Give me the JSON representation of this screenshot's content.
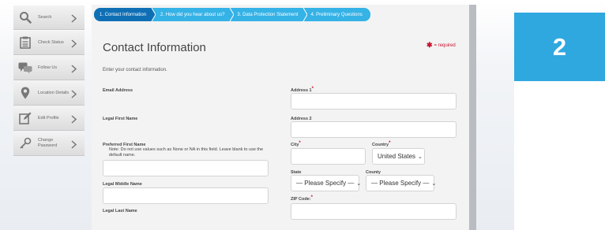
{
  "sidebar": {
    "items": [
      {
        "label": "Search",
        "icon": "search-icon"
      },
      {
        "label": "Check Status",
        "icon": "clipboard-icon"
      },
      {
        "label": "Follow Us",
        "icon": "chat-bubbles-icon"
      },
      {
        "label": "Location Details",
        "icon": "map-pin-icon"
      },
      {
        "label": "Edit Profile",
        "icon": "edit-icon"
      },
      {
        "label": "Change\nPassword",
        "icon": "key-icon"
      }
    ]
  },
  "steps": [
    {
      "label": "1. Contact Information",
      "active": true
    },
    {
      "label": "2. How did you hear about us?",
      "active": false
    },
    {
      "label": "3. Data Protection Statement",
      "active": false
    },
    {
      "label": "4. Preliminary Questions",
      "active": false
    }
  ],
  "form": {
    "title": "Contact Information",
    "required_note": "= required",
    "intro": "Enter your contact information.",
    "fields": {
      "email_label": "Email Address",
      "legal_first_label": "Legal First Name",
      "preferred_first_label": "Preferred First Name",
      "preferred_first_note": "Note: Do not use values such as None or NA in this field. Leave blank to use the default name.",
      "legal_middle_label": "Legal Middle Name",
      "legal_last_label": "Legal Last Name",
      "address1_label": "Address 1",
      "address2_label": "Address 2",
      "city_label": "City",
      "country_label": "Country",
      "country_value": "United States",
      "state_label": "State",
      "state_value": "— Please Specify —",
      "county_label": "County",
      "county_value": "— Please Specify —",
      "zip_label": "ZIP Code:"
    }
  },
  "badge": {
    "number": "2"
  },
  "colors": {
    "step_active": "#0f6fb5",
    "step_inactive": "#35b2e6",
    "badge": "#2fa8e0",
    "required": "#c8102e"
  }
}
